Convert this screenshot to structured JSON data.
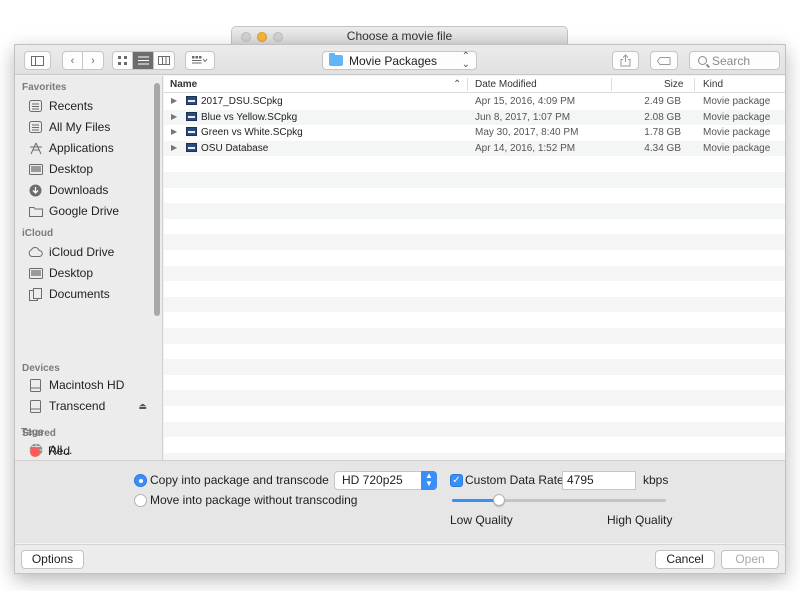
{
  "window": {
    "title": "Choose a movie file"
  },
  "toolbar": {
    "location": "Movie Packages",
    "search_placeholder": "Search"
  },
  "sidebar": {
    "sections": [
      {
        "title": "Favorites",
        "items": [
          {
            "label": "Recents",
            "icon": "recents-icon"
          },
          {
            "label": "All My Files",
            "icon": "all-files-icon"
          },
          {
            "label": "Applications",
            "icon": "applications-icon"
          },
          {
            "label": "Desktop",
            "icon": "desktop-icon"
          },
          {
            "label": "Downloads",
            "icon": "downloads-icon"
          },
          {
            "label": "Google Drive",
            "icon": "folder-icon"
          }
        ]
      },
      {
        "title": "iCloud",
        "items": [
          {
            "label": "iCloud Drive",
            "icon": "cloud-icon"
          },
          {
            "label": "Desktop",
            "icon": "desktop-icon"
          },
          {
            "label": "Documents",
            "icon": "documents-icon"
          }
        ]
      },
      {
        "title": "Devices",
        "items": [
          {
            "label": "Macintosh HD",
            "icon": "disk-icon"
          },
          {
            "label": "Transcend",
            "icon": "disk-icon",
            "eject": "⏏"
          }
        ]
      },
      {
        "title": "Shared",
        "items": [
          {
            "label": "All...",
            "icon": "network-icon"
          }
        ]
      },
      {
        "title": "Tags",
        "items": [
          {
            "label": "Red",
            "icon": "tag-red-icon",
            "color": "#fc5b57"
          }
        ]
      }
    ]
  },
  "filelist": {
    "columns": {
      "name": "Name",
      "date": "Date Modified",
      "size": "Size",
      "kind": "Kind"
    },
    "rows": [
      {
        "name": "2017_DSU.SCpkg",
        "date": "Apr 15, 2016, 4:09 PM",
        "size": "2.49 GB",
        "kind": "Movie package"
      },
      {
        "name": "Blue vs Yellow.SCpkg",
        "date": "Jun 8, 2017, 1:07 PM",
        "size": "2.08 GB",
        "kind": "Movie package"
      },
      {
        "name": "Green vs White.SCpkg",
        "date": "May 30, 2017, 8:40 PM",
        "size": "1.78 GB",
        "kind": "Movie package"
      },
      {
        "name": "OSU Database",
        "date": "Apr 14, 2016, 1:52 PM",
        "size": "4.34 GB",
        "kind": "Movie package"
      }
    ]
  },
  "options": {
    "copy_label": "Copy into package and transcode",
    "move_label": "Move into package without transcoding",
    "selected_mode": "copy",
    "format": "HD 720p25",
    "custom_rate_label": "Custom Data Rate",
    "custom_rate_checked": true,
    "rate_value": "4795",
    "rate_unit": "kbps",
    "quality_low": "Low Quality",
    "quality_high": "High Quality",
    "quality_level": 0.22,
    "accent": "#3a8ef8"
  },
  "bottom": {
    "options": "Options",
    "cancel": "Cancel",
    "open": "Open"
  }
}
